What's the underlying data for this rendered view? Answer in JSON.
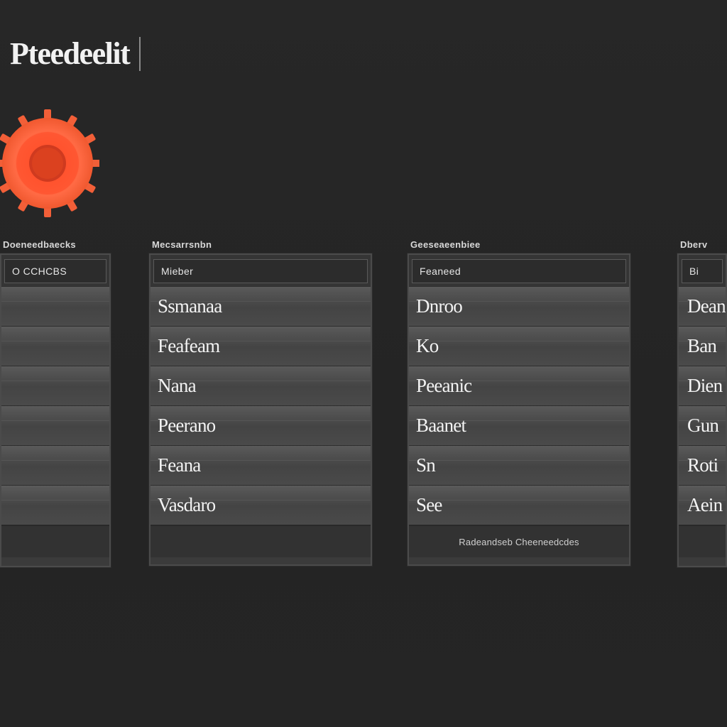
{
  "app": {
    "title": "Pteedeelit",
    "accent_color": "#ff5a36",
    "logo_icon": "gear-icon"
  },
  "columns": [
    {
      "header": "Doeneedbaecks",
      "search_placeholder": "O CCHCBS",
      "items": [
        {
          "label": ""
        },
        {
          "label": ""
        },
        {
          "label": ""
        },
        {
          "label": ""
        },
        {
          "label": ""
        },
        {
          "label": ""
        }
      ],
      "footer": ""
    },
    {
      "header": "Mecsarrsnbn",
      "search_placeholder": "Mieber",
      "items": [
        {
          "label": "Ssmanaa"
        },
        {
          "label": "Feafeam"
        },
        {
          "label": "Nana"
        },
        {
          "label": "Peerano"
        },
        {
          "label": "Feana"
        },
        {
          "label": "Vasdaro"
        }
      ],
      "footer": ""
    },
    {
      "header": "Geeseaeenbiee",
      "search_placeholder": "Feaneed",
      "items": [
        {
          "label": "Dnroo"
        },
        {
          "label": "Ko"
        },
        {
          "label": "Peeanic"
        },
        {
          "label": "Baanet"
        },
        {
          "label": "Sn"
        },
        {
          "label": "See"
        }
      ],
      "footer": "Radeandseb Cheeneedcdes"
    },
    {
      "header": "Dberv",
      "search_placeholder": "Bi",
      "items": [
        {
          "label": "Dean"
        },
        {
          "label": "Ban"
        },
        {
          "label": "Dien"
        },
        {
          "label": "Gun"
        },
        {
          "label": "Roti"
        },
        {
          "label": "Aein"
        }
      ],
      "footer": ""
    }
  ]
}
